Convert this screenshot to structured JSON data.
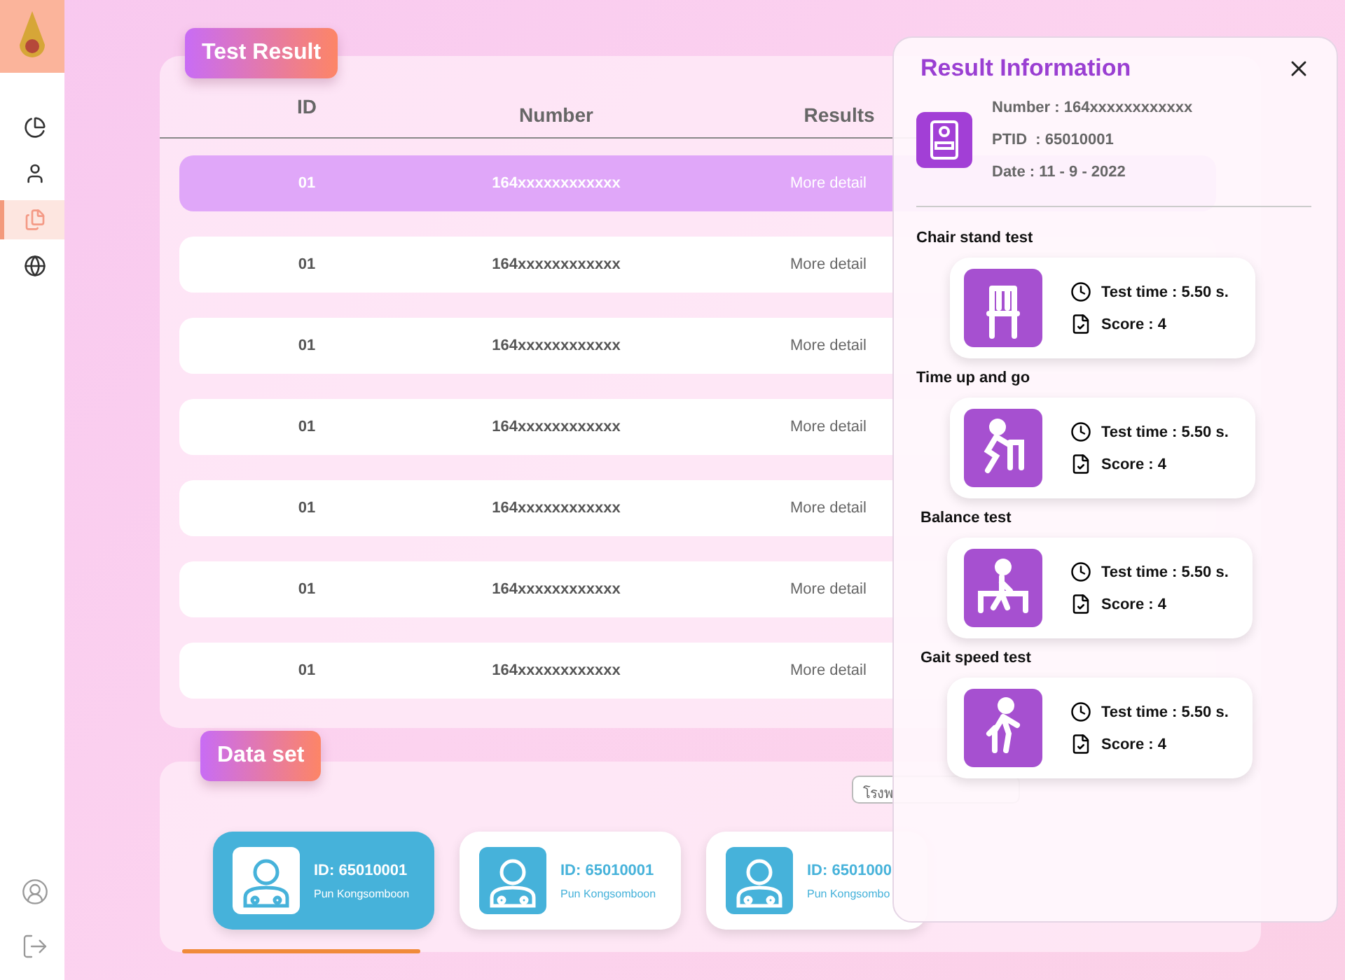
{
  "sidebar": {
    "items": [
      {
        "kind": "chart",
        "selected": false
      },
      {
        "kind": "user",
        "selected": false
      },
      {
        "kind": "file",
        "selected": true
      },
      {
        "kind": "globe",
        "selected": false
      }
    ],
    "bottom": [
      {
        "kind": "account"
      },
      {
        "kind": "logout"
      }
    ]
  },
  "test_result": {
    "title": "Test Result",
    "columns": [
      "ID",
      "Number",
      "Results"
    ],
    "rows": [
      {
        "id": "01",
        "number": "164xxxxxxxxxxxx",
        "result": "More detail",
        "selected": true
      },
      {
        "id": "01",
        "number": "164xxxxxxxxxxxx",
        "result": "More detail",
        "selected": false
      },
      {
        "id": "01",
        "number": "164xxxxxxxxxxxx",
        "result": "More detail",
        "selected": false
      },
      {
        "id": "01",
        "number": "164xxxxxxxxxxxx",
        "result": "More detail",
        "selected": false
      },
      {
        "id": "01",
        "number": "164xxxxxxxxxxxx",
        "result": "More detail",
        "selected": false
      },
      {
        "id": "01",
        "number": "164xxxxxxxxxxxx",
        "result": "More detail",
        "selected": false
      },
      {
        "id": "01",
        "number": "164xxxxxxxxxxxx",
        "result": "More detail",
        "selected": false
      }
    ]
  },
  "data_set": {
    "title": "Data set",
    "search": {
      "value": "โรงพ"
    },
    "cards": [
      {
        "id": "ID: 65010001",
        "name": "Pun Kongsomboon",
        "selected": true
      },
      {
        "id": "ID: 65010001",
        "name": "Pun Kongsomboon",
        "selected": false
      },
      {
        "id": "ID: 6501000",
        "name": "Pun Kongsombo",
        "selected": false
      }
    ]
  },
  "result_info": {
    "title": "Result Information",
    "details": [
      "Number : 164xxxxxxxxxxxx",
      "PTID  : 65010001",
      "Date : 11 - 9 - 2022"
    ],
    "tests": [
      {
        "name": "Chair stand test",
        "kind": "chair",
        "time": "Test time : 5.50 s.",
        "score": "Score : 4"
      },
      {
        "name": "Time up and go",
        "kind": "walker",
        "time": "Test time : 5.50 s.",
        "score": "Score : 4"
      },
      {
        "name": "Balance test",
        "kind": "balance",
        "time": "Test time : 5.50 s.",
        "score": "Score : 4"
      },
      {
        "name": "Gait speed test",
        "kind": "walk",
        "time": "Test time : 5.50 s.",
        "score": "Score : 4"
      }
    ]
  }
}
